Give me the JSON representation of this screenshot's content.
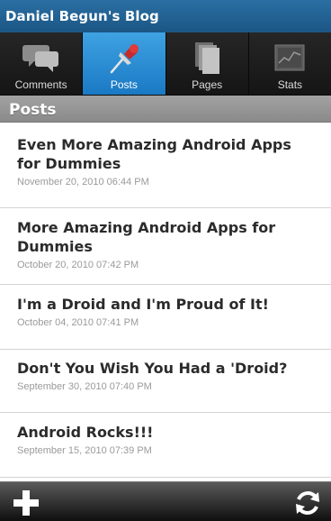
{
  "app": {
    "title": "Daniel Begun's Blog"
  },
  "tabs": [
    {
      "label": "Comments",
      "icon": "comments-icon",
      "active": false
    },
    {
      "label": "Posts",
      "icon": "pushpin-icon",
      "active": true
    },
    {
      "label": "Pages",
      "icon": "pages-icon",
      "active": false
    },
    {
      "label": "Stats",
      "icon": "stats-icon",
      "active": false
    }
  ],
  "section": {
    "title": "Posts"
  },
  "posts": [
    {
      "title": "Even More Amazing Android Apps for Dummies",
      "date": "November 20, 2010 06:44 PM"
    },
    {
      "title": "More Amazing Android Apps for Dummies",
      "date": "October 20, 2010 07:42 PM"
    },
    {
      "title": "I'm a Droid and I'm Proud of It!",
      "date": "October 04, 2010 07:41 PM"
    },
    {
      "title": "Don't You Wish You Had a 'Droid?",
      "date": "September 30, 2010 07:40 PM"
    },
    {
      "title": "Android Rocks!!!",
      "date": "September 15, 2010 07:39 PM"
    }
  ],
  "toolbar": {
    "add_icon": "plus-icon",
    "refresh_icon": "refresh-icon"
  },
  "colors": {
    "titlebar": "#1b5684",
    "active_tab": "#2b8fd6",
    "section_header": "#959595"
  }
}
